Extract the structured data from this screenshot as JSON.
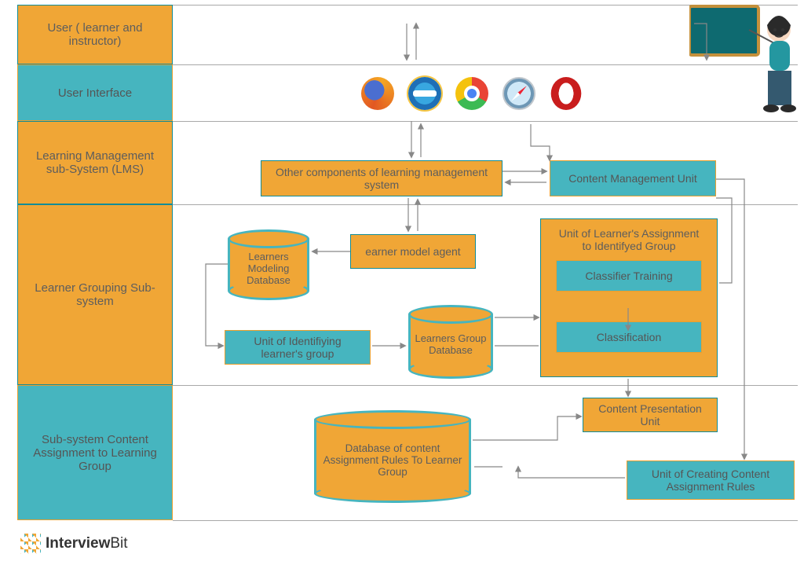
{
  "rows": {
    "user": "User ( learner and instructor)",
    "ui": "User Interface",
    "lms": "Learning Management sub-System (LMS)",
    "group": "Learner Grouping Sub-system",
    "assign": "Sub-system Content Assignment to Learning Group"
  },
  "boxes": {
    "other_lms": "Other components of learning management system",
    "content_mgmt": "Content Management Unit",
    "earner_agent": "earner model agent",
    "learners_modeling_db": "Learners Modeling Database",
    "unit_identify": "Unit of Identifiying learner's group",
    "learners_group_db": "Learners Group Database",
    "assign_group_title": "Unit of Learner's Assignment to Identifyed Group",
    "classifier_training": "Classifier Training",
    "classification": "Classification",
    "content_presentation": "Content Presentation Unit",
    "db_rules": "Database of content Assignment Rules To Learner Group",
    "unit_rules": "Unit of Creating Content Assignment Rules"
  },
  "browsers": [
    "firefox",
    "ie",
    "chrome",
    "safari",
    "opera"
  ],
  "brand": {
    "name": "InterviewBit",
    "strong": "Interview",
    "light": "Bit"
  }
}
